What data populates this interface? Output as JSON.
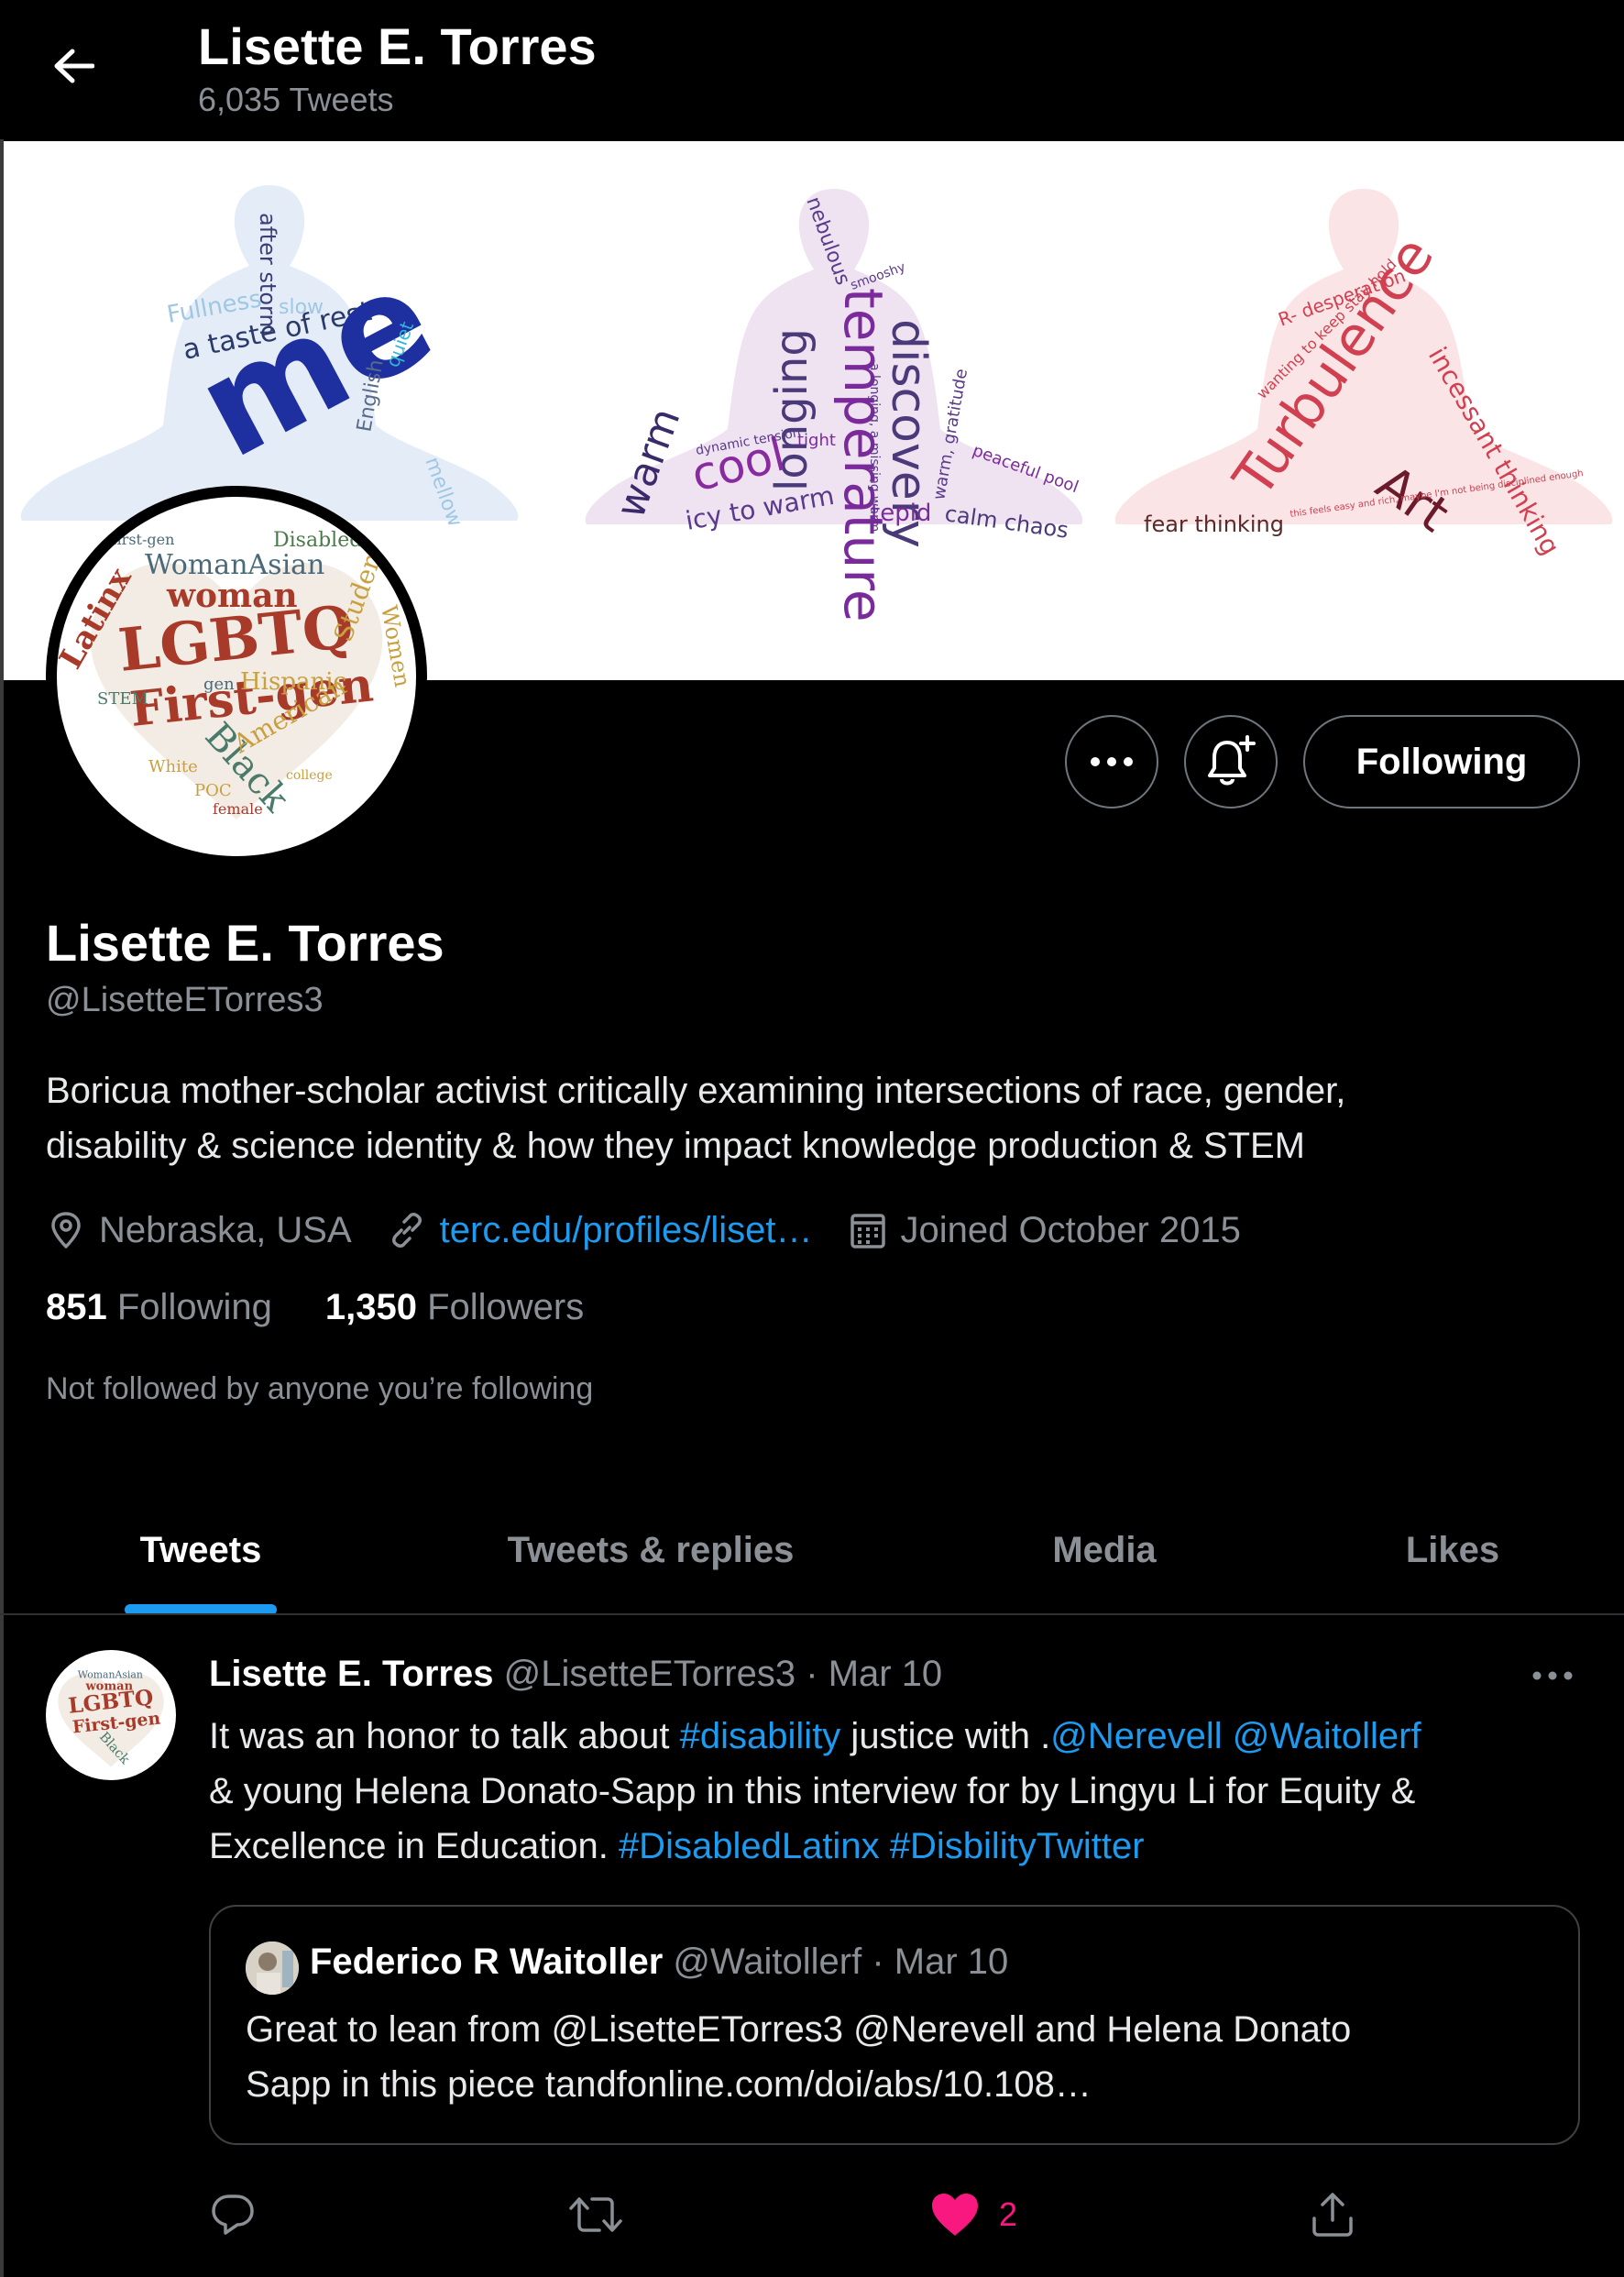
{
  "header": {
    "title": "Lisette E. Torres",
    "tweet_count": "6,035 Tweets"
  },
  "banner": {
    "panels": [
      {
        "words": [
          "after storm",
          "a taste of rest",
          "me",
          "Fullness",
          "slow",
          "mellow",
          "English",
          "quiet"
        ],
        "color": "#5a7bb8"
      },
      {
        "words": [
          "nebulous",
          "temperature",
          "discovery",
          "longing",
          "warm",
          "cool",
          "icy to warm",
          "tepid",
          "calm chaos",
          "peaceful pool",
          "warm, gratitude",
          "smooshy",
          "dynamic tension",
          "tight",
          "a longing, a missing warm"
        ],
        "color": "#7a4aa0"
      },
      {
        "words": [
          "Turbulence",
          "Art",
          "fear thinking",
          "incessant thinking",
          "R- desperation",
          "wanting to keep stay hold",
          "this feels easy and rich, maybe I'm not being disciplined enough"
        ],
        "color": "#d0505a"
      }
    ]
  },
  "avatar": {
    "words": [
      "LGBTQ",
      "First-gen",
      "woman",
      "WomanAsian",
      "Latinx",
      "Black",
      "Student",
      "Women",
      "Hispanic",
      "American",
      "Disabled",
      "STEM",
      "White",
      "POC",
      "female",
      "college",
      "first-gen",
      "gen"
    ]
  },
  "actions": {
    "following_label": "Following"
  },
  "profile": {
    "name": "Lisette E. Torres",
    "handle": "@LisetteETorres3",
    "bio_line1": "Boricua mother-scholar activist critically examining intersections of race, gender,",
    "bio_line2": "disability & science identity & how they impact knowledge production & STEM",
    "location": "Nebraska, USA",
    "website": "terc.edu/profiles/liset…",
    "joined": "Joined October 2015",
    "following_count": "851",
    "following_label": "Following",
    "followers_count": "1,350",
    "followers_label": "Followers",
    "not_followed": "Not followed by anyone you’re following"
  },
  "tabs": [
    {
      "label": "Tweets"
    },
    {
      "label": "Tweets & replies"
    },
    {
      "label": "Media"
    },
    {
      "label": "Likes"
    }
  ],
  "tweet": {
    "author": "Lisette E. Torres",
    "handle": "@LisetteETorres3",
    "separator": "·",
    "date": "Mar 10",
    "text": {
      "t1": "It was an honor to talk about ",
      "l1": "#disability",
      "t2": " justice with .",
      "l2": "@Nerevell",
      "t3": " ",
      "l3": "@Waitollerf",
      "line2": "& young Helena Donato-Sapp in this interview for by Lingyu Li for Equity &",
      "t4": "Excellence in Education. ",
      "l4": "#DisabledLatinx",
      "t5": " ",
      "l5": "#DisbilityTwitter"
    },
    "quote": {
      "author": "Federico R Waitoller",
      "handle": "@Waitollerf",
      "separator": "·",
      "date": "Mar 10",
      "line1": "Great to lean from @LisetteETorres3 @Nerevell and Helena Donato",
      "line2": "Sapp in this piece tandfonline.com/doi/abs/10.108…"
    },
    "like_count": "2",
    "like_color": "#f91880"
  },
  "icons": {
    "back": "arrow-left-icon",
    "more": "more-horizontal-icon",
    "bell": "notification-bell-plus-icon",
    "location": "map-pin-icon",
    "link": "link-icon",
    "calendar": "calendar-icon",
    "reply": "reply-icon",
    "retweet": "retweet-icon",
    "like": "heart-filled-icon",
    "share": "share-icon"
  },
  "colors": {
    "accent": "#1d9bf0",
    "background": "#000000",
    "secondary_text": "#8b9096"
  }
}
